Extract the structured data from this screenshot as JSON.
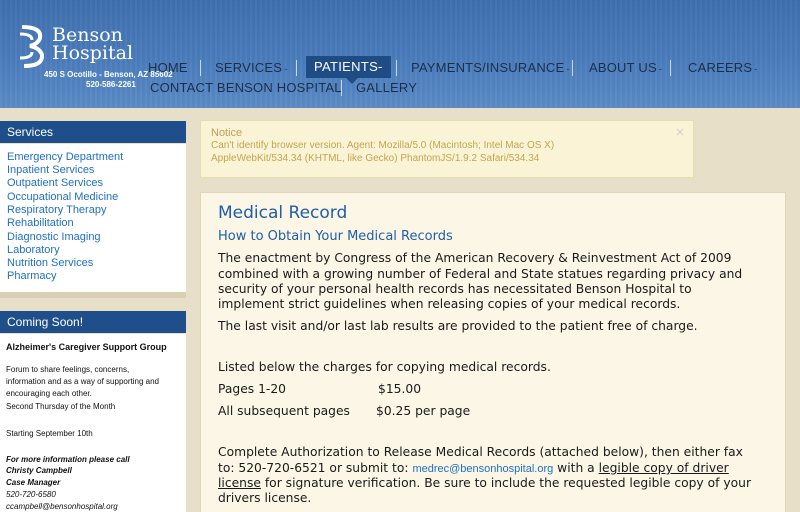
{
  "header": {
    "logo_line1": "Benson",
    "logo_line2": "Hospital",
    "address": "450 S Ocotillo - Benson, AZ 85602",
    "phone": "520-586-2261",
    "nav": {
      "home": "HOME",
      "services": "SERVICES",
      "patients": "PATIENTS",
      "payments": "PAYMENTS/INSURANCE",
      "about": "ABOUT US",
      "careers": "CAREERS",
      "contact": "CONTACT BENSON HOSPITAL",
      "gallery": "GALLERY",
      "caret": "-"
    }
  },
  "sidebar": {
    "services_title": "Services",
    "services_items": [
      "Emergency Department",
      "Inpatient Services",
      "Outpatient Services",
      "Occupational Medicine",
      "Respiratory Therapy",
      "Rehabilitation",
      "Diagnostic Imaging",
      "Laboratory",
      "Nutrition Services",
      "Pharmacy"
    ],
    "coming_title": "Coming Soon!",
    "coming": {
      "heading": "Alzheimer's Caregiver Support Group",
      "desc1": "Forum to share feelings, concerns,",
      "desc2": "information and as a way of supporting and",
      "desc3": "encouraging each other.",
      "desc4": "Second Thursday of the Month",
      "start": "Starting September 10th",
      "info": "For more information please call",
      "name": "Christy Campbell",
      "role": "Case Manager",
      "phone": "520-720-6580",
      "email": "ccampbell@bensonhospital.org"
    }
  },
  "notice": {
    "title": "Notice",
    "close": "×",
    "line1": "Can't identify browser version. Agent: Mozilla/5.0 (Macintosh; Intel Mac OS X)",
    "line2": "AppleWebKit/534.34 (KHTML, like Gecko) PhantomJS/1.9.2 Safari/534.34"
  },
  "main": {
    "title": "Medical Record",
    "subtitle": "How to Obtain Your Medical Records",
    "p1": [
      "The enactment by Congress of the American Recovery & Reinvestment Act of 2009",
      "combined with a growing number of Federal and State statues regarding privacy and",
      "security of your personal health records has necessitated Benson Hospital to",
      "implement strict guidelines when releasing copies of your medical records."
    ],
    "p2": "The last visit and/or last lab results are provided to the patient free of charge.",
    "charges_intro": "Listed below the charges for copying medical records.",
    "pages_label": "Pages 1-20",
    "pages_price": "$15.00",
    "subsequent_label": "All subsequent pages",
    "subsequent_price": "$0.25 per page",
    "p3_line1": "Complete Authorization to Release Medical Records (attached below), then either fax",
    "p3_line2_a": "to: 520-720-6521 or submit to: ",
    "p3_email": "medrec@bensonhospital.org",
    "p3_line2_b": " with a ",
    "p3_link_a": "legible copy of driver",
    "p3_link_b": "license",
    "p3_line3": " for signature verification. Be sure to include the requested legible copy of your",
    "p3_line4": "drivers license."
  }
}
